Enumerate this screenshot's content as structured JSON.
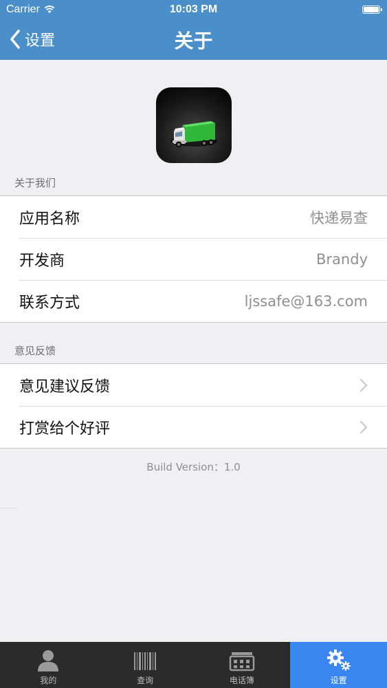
{
  "status_bar": {
    "carrier": "Carrier",
    "time": "10:03 PM"
  },
  "nav": {
    "back_label": "设置",
    "title": "关于"
  },
  "sections": {
    "about": {
      "header": "关于我们",
      "rows": [
        {
          "label": "应用名称",
          "value": "快递易查"
        },
        {
          "label": "开发商",
          "value": "Brandy"
        },
        {
          "label": "联系方式",
          "value": "ljssafe@163.com"
        }
      ]
    },
    "feedback": {
      "header": "意见反馈",
      "rows": [
        {
          "label": "意见建议反馈"
        },
        {
          "label": "打赏给个好评"
        }
      ]
    }
  },
  "build_version": "Build Version：1.0",
  "tabs": [
    {
      "label": "我的",
      "icon": "person-icon"
    },
    {
      "label": "查询",
      "icon": "barcode-icon"
    },
    {
      "label": "电话簿",
      "icon": "phonebook-icon"
    },
    {
      "label": "设置",
      "icon": "gear-icon",
      "active": true
    }
  ],
  "colors": {
    "nav_bg": "#4a8fc9",
    "tab_active": "#3a86f0",
    "tab_bg": "#2b2b2b",
    "background": "#efeff4"
  }
}
